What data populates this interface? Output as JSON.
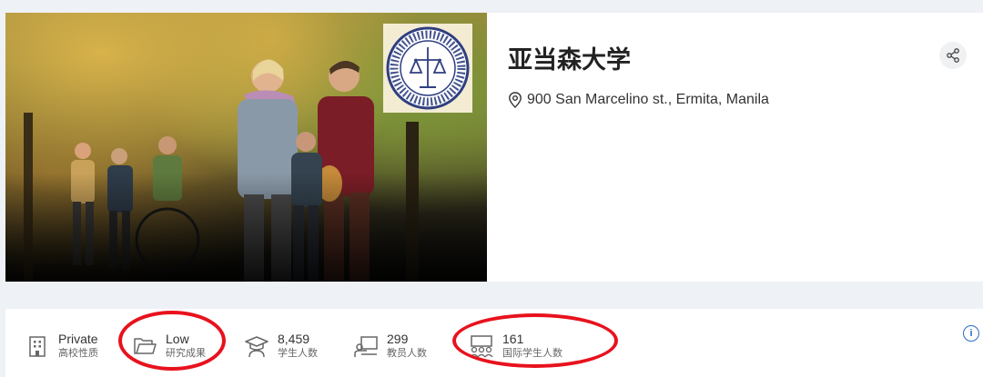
{
  "university": {
    "name": "亚当森大学",
    "address": "900 San Marcelino st., Ermita, Manila",
    "logo_text": "ADAMSON UNIVERSITY · MANILA, PHILIPPINES"
  },
  "stats": [
    {
      "value": "Private",
      "label": "高校性质",
      "icon": "building-icon"
    },
    {
      "value": "Low",
      "label": "研究成果",
      "icon": "folder-icon"
    },
    {
      "value": "8,459",
      "label": "学生人数",
      "icon": "graduation-cap-icon"
    },
    {
      "value": "299",
      "label": "教员人数",
      "icon": "teacher-icon"
    },
    {
      "value": "161",
      "label": "国际学生人数",
      "icon": "group-icon"
    }
  ],
  "colors": {
    "highlight_circle": "#e8121d",
    "info_icon": "#2b6cc4",
    "page_bg": "#eef1f6"
  }
}
